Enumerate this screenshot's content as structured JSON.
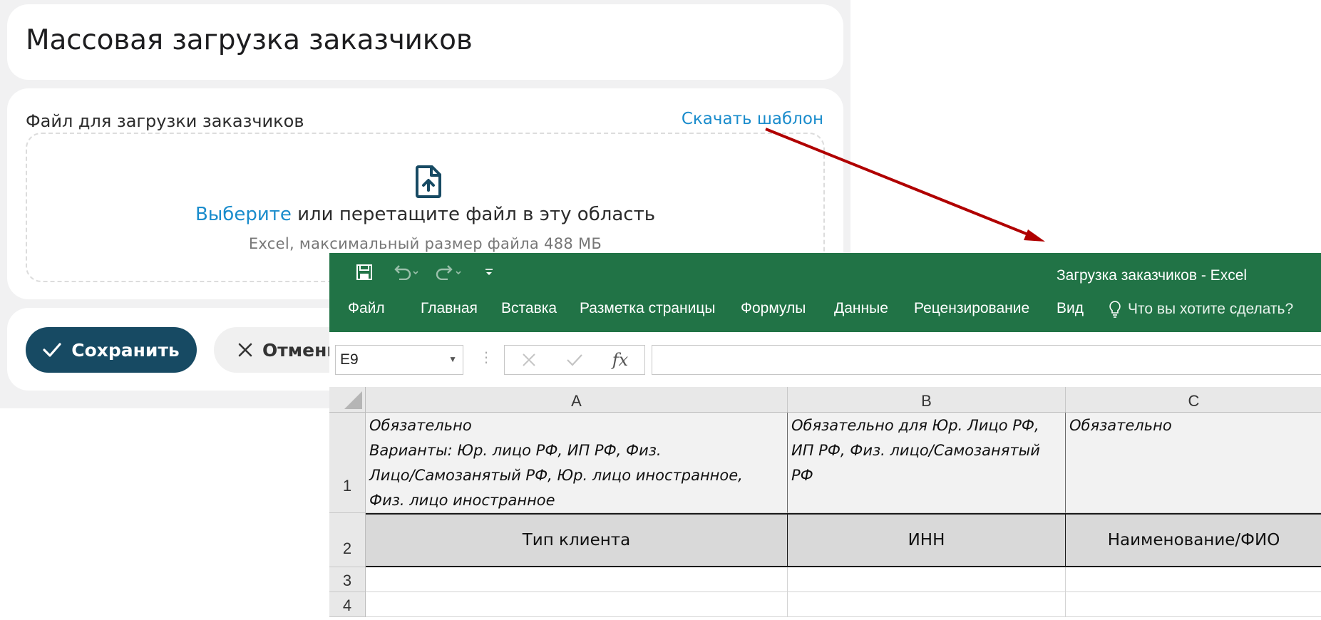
{
  "app": {
    "page_title": "Массовая загрузка заказчиков",
    "upload": {
      "field_label": "Файл для загрузки заказчиков",
      "download_template_link": "Скачать шаблон",
      "choose_link": "Выберите",
      "drop_text": " или перетащите файл в эту область",
      "hint": "Excel, максимальный размер файла 488 МБ",
      "icon": "file-upload-icon"
    },
    "actions": {
      "save_label": "Сохранить",
      "cancel_label": "Отмени"
    },
    "colors": {
      "primary": "#174a63",
      "link": "#1a8ccc"
    }
  },
  "excel": {
    "window_title": "Загрузка заказчиков - Excel",
    "ribbon_color": "#217346",
    "quick_access": [
      "save-icon",
      "undo-icon",
      "redo-icon",
      "customize-qat-icon"
    ],
    "menu": [
      "Файл",
      "Главная",
      "Вставка",
      "Разметка страницы",
      "Формулы",
      "Данные",
      "Рецензирование",
      "Вид"
    ],
    "tell_me": "Что вы хотите сделать?",
    "name_box": "E9",
    "fx_label": "fx",
    "columns": [
      "A",
      "B",
      "C"
    ],
    "rows": [
      "1",
      "2",
      "3",
      "4"
    ],
    "row1": {
      "a": "Обязательно\nВарианты: Юр. лицо РФ, ИП РФ, Физ.\nЛицо/Самозанятый РФ, Юр. лицо иностранное,\nФиз. лицо иностранное",
      "b": "Обязательно для Юр. Лицо РФ,\nИП РФ, Физ. лицо/Самозанятый\nРФ",
      "c": "Обязательно"
    },
    "row2": {
      "a": "Тип клиента",
      "b": "ИНН",
      "c": "Наименование/ФИО"
    },
    "arrow_color": "#b00000"
  }
}
